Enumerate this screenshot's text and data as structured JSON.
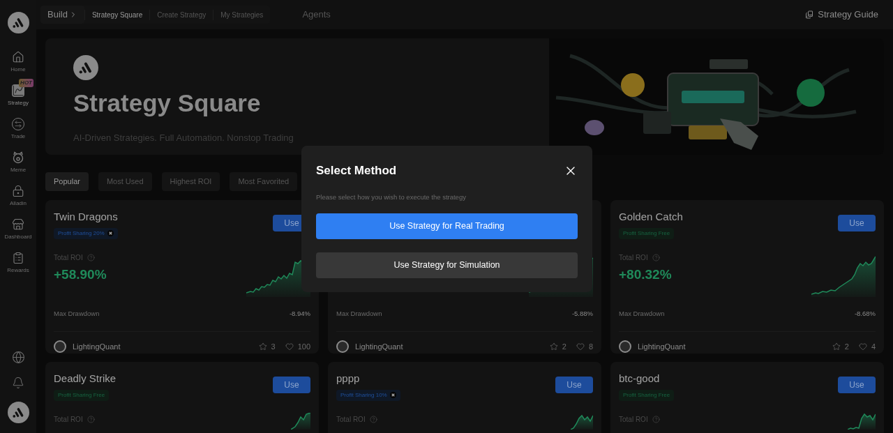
{
  "sidebar": {
    "items": [
      {
        "label": "Home",
        "selected": false
      },
      {
        "label": "Strategy",
        "selected": true,
        "badge": "HOT"
      },
      {
        "label": "Trade",
        "selected": false
      },
      {
        "label": "Meme",
        "selected": false
      },
      {
        "label": "Alladin",
        "selected": false
      },
      {
        "label": "Dashboard",
        "selected": false
      },
      {
        "label": "Rewards",
        "selected": false
      }
    ]
  },
  "top_nav": {
    "section": "Build",
    "tabs": [
      {
        "label": "Strategy Square",
        "selected": true
      },
      {
        "label": "Create Strategy",
        "selected": false
      },
      {
        "label": "My Strategies",
        "selected": false
      }
    ],
    "agents": "Agents",
    "guide": "Strategy Guide"
  },
  "hero": {
    "title": "Strategy Square",
    "subtitle": "AI-Driven Strategies. Full Automation. Nonstop Trading"
  },
  "filter_tabs": [
    {
      "label": "Popular",
      "selected": true
    },
    {
      "label": "Most Used",
      "selected": false
    },
    {
      "label": "Highest ROI",
      "selected": false
    },
    {
      "label": "Most Favorited",
      "selected": false
    }
  ],
  "cards": [
    {
      "title": "Twin Dragons",
      "tag": {
        "kind": "share",
        "label": "Profit Sharing 20%"
      },
      "use": "Use",
      "roi_label": "Total ROI",
      "roi": "+58.90%",
      "drawdown_label": "Max Drawdown",
      "drawdown": "-8.94%",
      "author": "LightingQuant",
      "stars": "3",
      "likes": "100"
    },
    {
      "drawdown_label": "Max Drawdown",
      "drawdown": "-5.88%",
      "author": "LightingQuant",
      "stars": "2",
      "likes": "8"
    },
    {
      "title": "Golden Catch",
      "tag": {
        "kind": "free",
        "label": "Profit Sharing Free"
      },
      "use": "Use",
      "roi_label": "Total ROI",
      "roi": "+80.32%",
      "drawdown_label": "Max Drawdown",
      "drawdown": "-8.68%",
      "author": "LightingQuant",
      "stars": "2",
      "likes": "4"
    },
    {
      "title": "Deadly Strike",
      "tag": {
        "kind": "free",
        "label": "Profit Sharing Free"
      },
      "use": "Use",
      "roi_label": "Total ROI"
    },
    {
      "title": "pppp",
      "tag": {
        "kind": "share",
        "label": "Profit Sharing 10%"
      },
      "use": "Use",
      "roi_label": "Total ROI"
    },
    {
      "title": "btc-good",
      "tag": {
        "kind": "free",
        "label": "Profit Sharing Free"
      },
      "use": "Use",
      "roi_label": "Total ROI"
    }
  ],
  "modal": {
    "title": "Select Method",
    "subtitle": "Please select how you wish to execute the strategy",
    "buttons": [
      {
        "label": "Use Strategy for Real Trading",
        "kind": "primary"
      },
      {
        "label": "Use Strategy for Simulation",
        "kind": "secondary"
      }
    ]
  }
}
